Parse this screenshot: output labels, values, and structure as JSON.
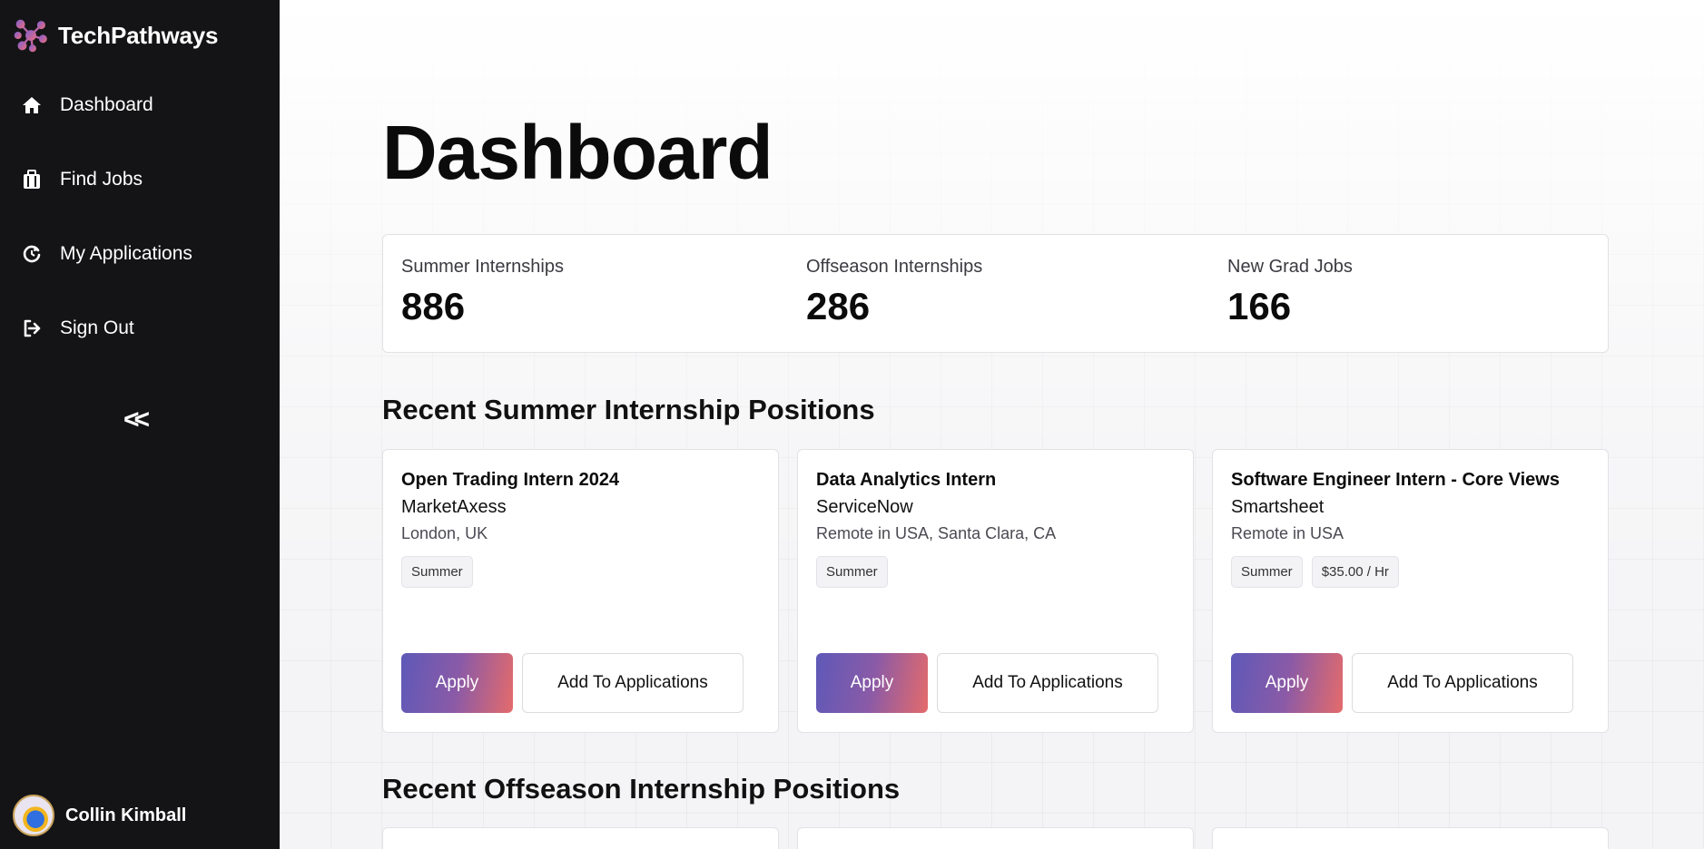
{
  "brand": {
    "name": "TechPathways",
    "icon": "molecule-logo-icon"
  },
  "sidebar": {
    "items": [
      {
        "label": "Dashboard",
        "icon": "home-icon"
      },
      {
        "label": "Find Jobs",
        "icon": "briefcase-icon"
      },
      {
        "label": "My Applications",
        "icon": "refresh-icon"
      },
      {
        "label": "Sign Out",
        "icon": "sign-out-icon"
      }
    ],
    "collapse_label": "<<",
    "user_name": "Collin Kimball"
  },
  "main": {
    "title": "Dashboard",
    "stats": [
      {
        "label": "Summer Internships",
        "value": "886"
      },
      {
        "label": "Offseason Internships",
        "value": "286"
      },
      {
        "label": "New Grad Jobs",
        "value": "166"
      }
    ],
    "summer_section_title": "Recent Summer Internship Positions",
    "offseason_section_title": "Recent Offseason Internship Positions",
    "apply_label": "Apply",
    "add_label": "Add To Applications",
    "summer_jobs": [
      {
        "title": "Open Trading Intern 2024",
        "company": "MarketAxess",
        "location": "London, UK",
        "tags": [
          "Summer"
        ]
      },
      {
        "title": "Data Analytics Intern",
        "company": "ServiceNow",
        "location": "Remote in USA, Santa Clara, CA",
        "tags": [
          "Summer"
        ]
      },
      {
        "title": "Software Engineer Intern - Core Views",
        "company": "Smartsheet",
        "location": "Remote in USA",
        "tags": [
          "Summer",
          "$35.00 / Hr"
        ]
      }
    ]
  },
  "colors": {
    "sidebar_bg": "#141416",
    "apply_gradient_start": "#5e59b8",
    "apply_gradient_end": "#e46b6b"
  }
}
